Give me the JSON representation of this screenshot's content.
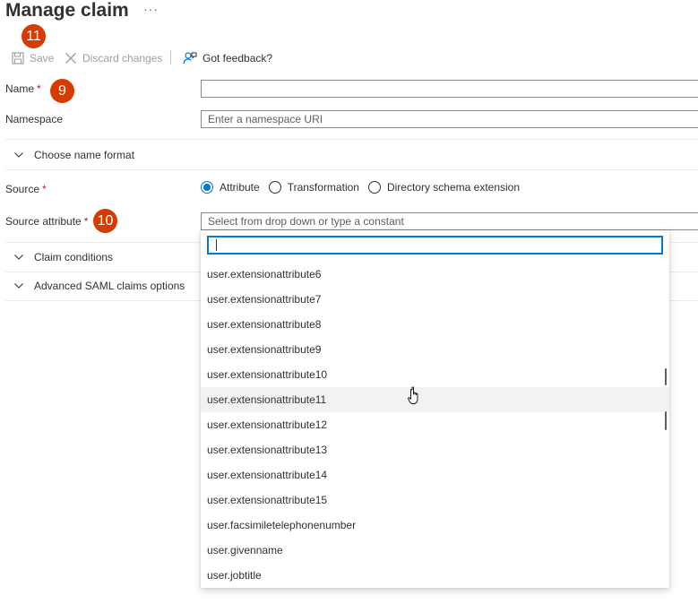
{
  "header": {
    "title": "Manage claim",
    "more": "···"
  },
  "toolbar": {
    "save_label": "Save",
    "discard_label": "Discard changes",
    "feedback_label": "Got feedback?"
  },
  "badges": {
    "save": "11",
    "name": "9",
    "source_attribute": "10"
  },
  "form": {
    "name_label": "Name",
    "required_mark": "*",
    "name_value": "",
    "namespace_label": "Namespace",
    "namespace_placeholder": "Enter a namespace URI",
    "choose_name_format": "Choose name format",
    "source_label": "Source",
    "source_options": [
      "Attribute",
      "Transformation",
      "Directory schema extension"
    ],
    "source_selected": "Attribute",
    "source_attribute_label": "Source attribute",
    "source_attribute_placeholder": "Select from drop down or type a constant",
    "claim_conditions": "Claim conditions",
    "advanced_saml": "Advanced SAML claims options"
  },
  "dropdown": {
    "search_value": "",
    "items": [
      "user.extensionattribute6",
      "user.extensionattribute7",
      "user.extensionattribute8",
      "user.extensionattribute9",
      "user.extensionattribute10",
      "user.extensionattribute11",
      "user.extensionattribute12",
      "user.extensionattribute13",
      "user.extensionattribute14",
      "user.extensionattribute15",
      "user.facsimiletelephonenumber",
      "user.givenname",
      "user.jobtitle"
    ],
    "hovered_item": "user.extensionattribute11"
  },
  "colors": {
    "accent": "#0078d4",
    "badge": "#d83b01",
    "required": "#a4262c"
  }
}
